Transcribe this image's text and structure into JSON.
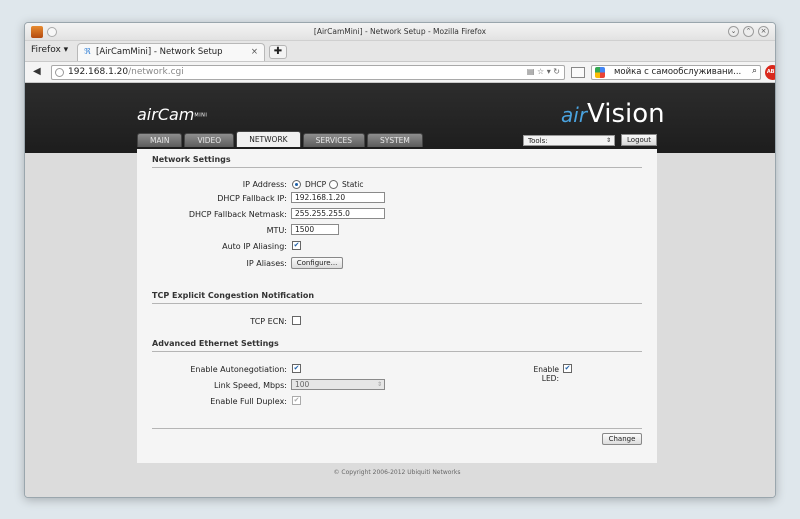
{
  "window": {
    "title": "[AirCamMini] - Network Setup - Mozilla Firefox"
  },
  "browser": {
    "menu_label": "Firefox ▾",
    "tab_title": "[AirCamMini] - Network Setup",
    "tab_close": "×",
    "new_tab": "✚",
    "url_host": "192.168.1.20",
    "url_path": "/network.cgi",
    "search_text": "мойка с самообслуживани...",
    "abp_label": "ABP"
  },
  "header": {
    "logo_air": "air",
    "logo_cam": "Cam",
    "logo_mini": "MINI",
    "brand_air": "air",
    "brand_vision": "Vision",
    "tools_label": "Tools:",
    "logout_label": "Logout"
  },
  "tabs": [
    {
      "label": "MAIN"
    },
    {
      "label": "VIDEO"
    },
    {
      "label": "NETWORK",
      "active": true
    },
    {
      "label": "SERVICES"
    },
    {
      "label": "SYSTEM"
    }
  ],
  "network": {
    "section_title": "Network Settings",
    "ip_address_label": "IP Address:",
    "dhcp_label": "DHCP",
    "static_label": "Static",
    "fallback_ip_label": "DHCP Fallback IP:",
    "fallback_ip_value": "192.168.1.20",
    "fallback_mask_label": "DHCP Fallback Netmask:",
    "fallback_mask_value": "255.255.255.0",
    "mtu_label": "MTU:",
    "mtu_value": "1500",
    "auto_alias_label": "Auto IP Aliasing:",
    "ip_aliases_label": "IP Aliases:",
    "configure_label": "Configure..."
  },
  "tcp": {
    "section_title": "TCP Explicit Congestion Notification",
    "ecn_label": "TCP ECN:"
  },
  "ethernet": {
    "section_title": "Advanced Ethernet Settings",
    "autoneg_label": "Enable Autonegotiation:",
    "led_label": "Enable LED:",
    "speed_label": "Link Speed, Mbps:",
    "speed_value": "100",
    "duplex_label": "Enable Full Duplex:"
  },
  "actions": {
    "change_label": "Change"
  },
  "footer": {
    "copyright": "© Copyright 2006-2012 Ubiquiti Networks"
  }
}
